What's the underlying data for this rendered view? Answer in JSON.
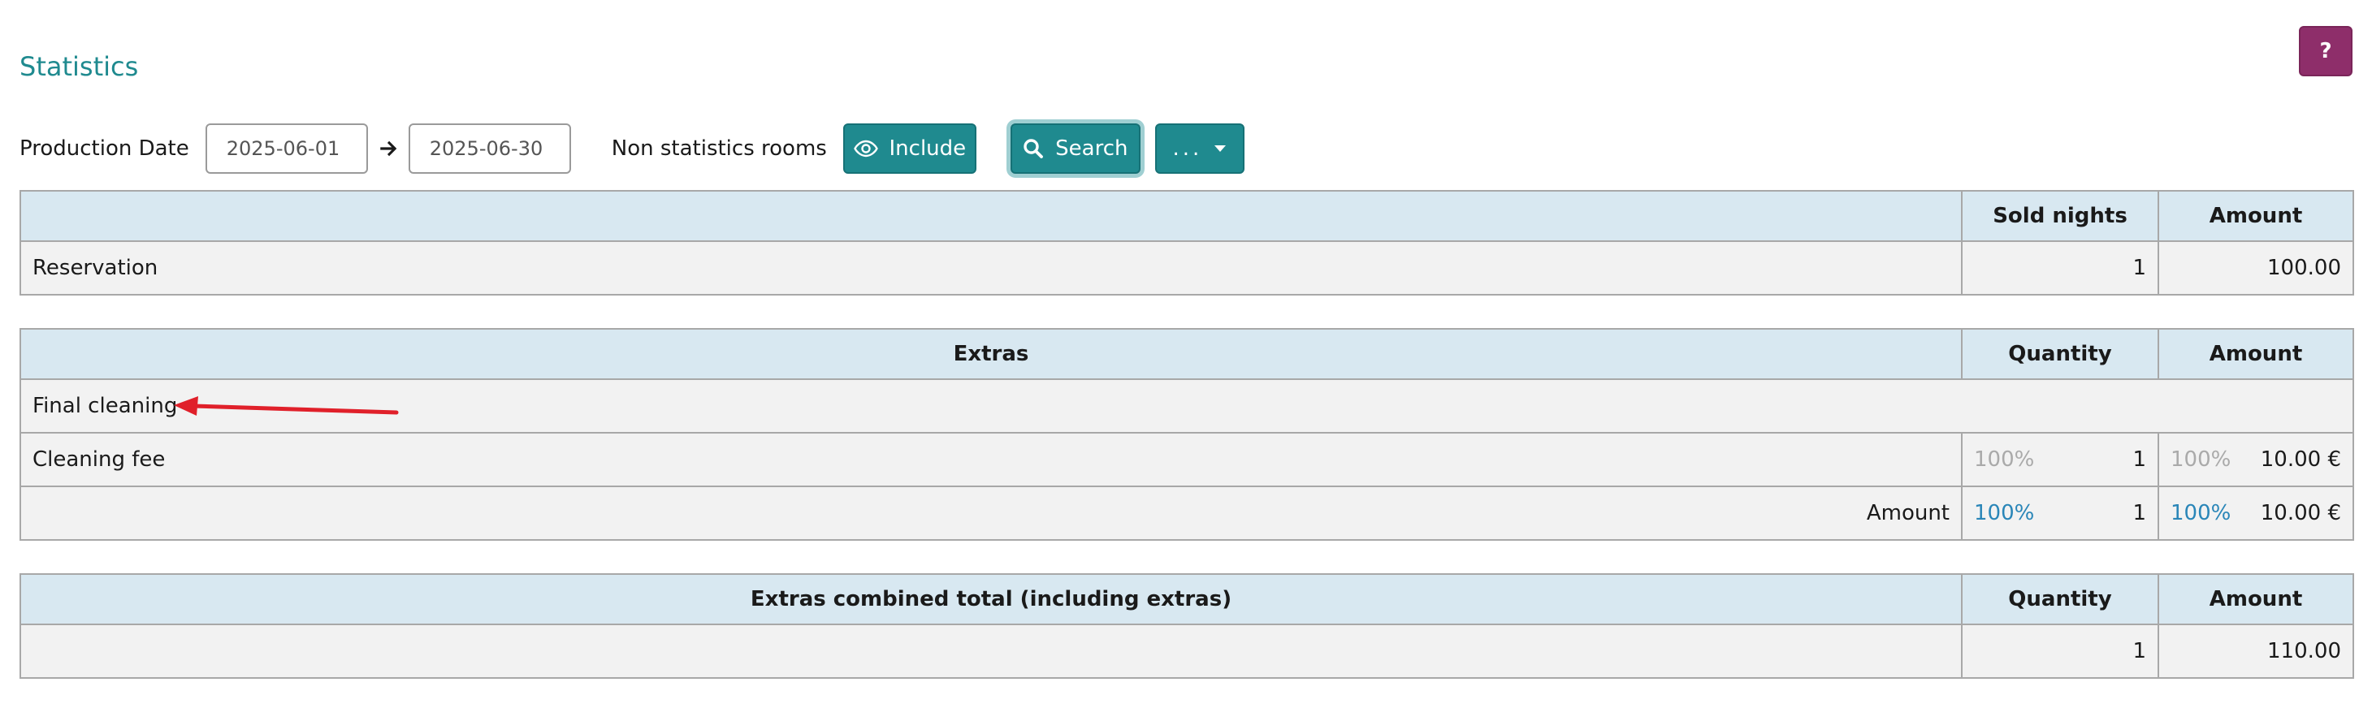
{
  "page": {
    "title": "Statistics",
    "help_label": "?"
  },
  "toolbar": {
    "production_date_label": "Production Date",
    "date_from": "2025-06-01",
    "date_to": "2025-06-30",
    "non_statistics_rooms_label": "Non statistics rooms",
    "include_label": "Include",
    "search_label": "Search",
    "more_label": "..."
  },
  "reservation_table": {
    "headers": [
      "",
      "Sold nights",
      "Amount"
    ],
    "rows": [
      {
        "label": "Reservation",
        "sold_nights": "1",
        "amount": "100.00"
      }
    ]
  },
  "extras_table": {
    "headers": [
      "Extras",
      "Quantity",
      "Amount"
    ],
    "category": "Final cleaning",
    "rows": [
      {
        "label": "Cleaning fee",
        "qty_pct": "100%",
        "qty": "1",
        "amt_pct": "100%",
        "amount": "10.00 €"
      }
    ],
    "total": {
      "label": "Amount",
      "qty_pct": "100%",
      "qty": "1",
      "amt_pct": "100%",
      "amount": "10.00 €"
    }
  },
  "combined_table": {
    "headers": [
      "Extras combined total (including extras)",
      "Quantity",
      "Amount"
    ],
    "rows": [
      {
        "label": "",
        "quantity": "1",
        "amount": "110.00"
      }
    ]
  },
  "colors": {
    "accent": "#1f8a8f",
    "help": "#8e2e6a",
    "category": "#e05a2b",
    "percent_highlight": "#2a86b8",
    "annotation": "#e0202a"
  },
  "icons": {
    "include": "eye-icon",
    "search": "search-icon",
    "more": "caret-down-icon",
    "date_range": "arrow-right-icon"
  }
}
